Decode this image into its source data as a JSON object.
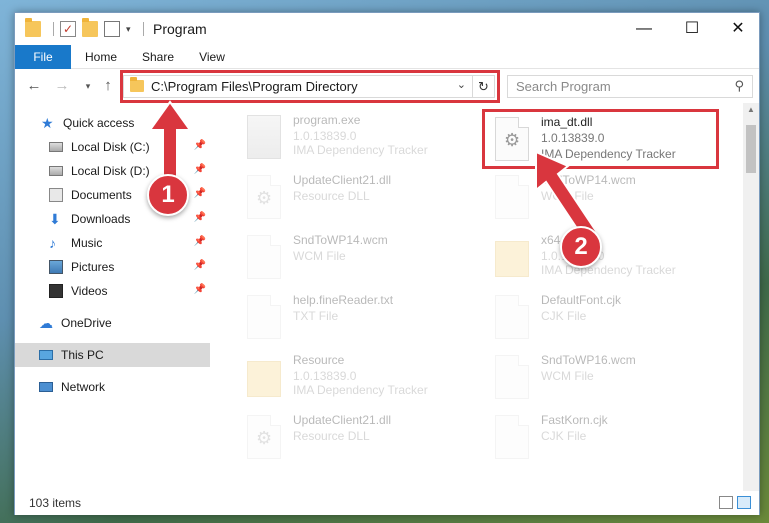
{
  "window": {
    "title": "Program",
    "controls": {
      "minimize": "—",
      "maximize": "☐",
      "close": "✕"
    }
  },
  "ribbon": {
    "tabs": [
      {
        "label": "File"
      },
      {
        "label": "Home"
      },
      {
        "label": "Share"
      },
      {
        "label": "View"
      }
    ]
  },
  "address": {
    "path": "C:\\Program Files\\Program Directory"
  },
  "search": {
    "placeholder": "Search Program"
  },
  "nav": {
    "items": [
      {
        "label": "Quick access",
        "icon": "star-icon"
      },
      {
        "label": "Local Disk (C:)",
        "icon": "drive-icon",
        "pinned": true
      },
      {
        "label": "Local Disk (D:)",
        "icon": "drive-icon",
        "pinned": true
      },
      {
        "label": "Documents",
        "icon": "documents-icon",
        "pinned": true
      },
      {
        "label": "Downloads",
        "icon": "download-icon",
        "pinned": true
      },
      {
        "label": "Music",
        "icon": "music-icon",
        "pinned": true
      },
      {
        "label": "Pictures",
        "icon": "pictures-icon",
        "pinned": true
      },
      {
        "label": "Videos",
        "icon": "videos-icon",
        "pinned": true
      },
      {
        "label": "OneDrive",
        "icon": "cloud-icon"
      },
      {
        "label": "This PC",
        "icon": "pc-icon",
        "selected": true
      },
      {
        "label": "Network",
        "icon": "network-icon"
      }
    ]
  },
  "files": [
    {
      "name": "program.exe",
      "line2": "1.0.13839.0",
      "line3": "IMA Dependency Tracker",
      "icon": "exe-icon"
    },
    {
      "name": "ima_dt.dll",
      "line2": "1.0.13839.0",
      "line3": "IMA Dependency Tracker",
      "icon": "dll-gear-icon",
      "highlighted": true
    },
    {
      "name": "UpdateClient21.dll",
      "line2": "Resource DLL",
      "icon": "dll-gear-icon"
    },
    {
      "name": "SndToWP14.wcm",
      "line2": "WCM File",
      "icon": "file-icon"
    },
    {
      "name": "SndToWP14.wcm",
      "line2": "WCM File",
      "icon": "file-icon"
    },
    {
      "name": "x64",
      "line2": "1.0.13839.0",
      "line3": "IMA Dependency Tracker",
      "icon": "folder-icon"
    },
    {
      "name": "help.fineReader.txt",
      "line2": "TXT File",
      "icon": "file-icon"
    },
    {
      "name": "DefaultFont.cjk",
      "line2": "CJK File",
      "icon": "file-icon"
    },
    {
      "name": "Resource",
      "line2": "1.0.13839.0",
      "line3": "IMA Dependency Tracker",
      "icon": "folder-icon"
    },
    {
      "name": "SndToWP16.wcm",
      "line2": "WCM File",
      "icon": "file-icon"
    },
    {
      "name": "UpdateClient21.dll",
      "line2": "Resource DLL",
      "icon": "dll-gear-icon"
    },
    {
      "name": "FastKorn.cjk",
      "line2": "CJK File",
      "icon": "file-icon"
    }
  ],
  "status": {
    "item_count": "103 items"
  },
  "annotations": {
    "step1": "1",
    "step2": "2",
    "color": "#d9363e"
  }
}
